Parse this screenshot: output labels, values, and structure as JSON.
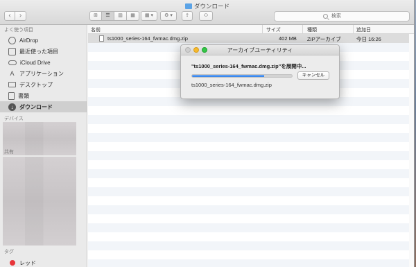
{
  "window": {
    "title": "ダウンロード"
  },
  "toolbar": {
    "back_label": "‹",
    "forward_label": "›",
    "view_buttons": [
      "⊞",
      "☰",
      "▥",
      "▦"
    ],
    "arrange_label": "▦ ▾",
    "action_label": "⚙ ▾",
    "share_label": "⇪",
    "tag_label": "⬭"
  },
  "search": {
    "placeholder": "検索"
  },
  "sidebar": {
    "favorites_header": "よく使う項目",
    "items": [
      {
        "label": "AirDrop",
        "icon": "airdrop-icon"
      },
      {
        "label": "最近使った項目",
        "icon": "recents-icon"
      },
      {
        "label": "iCloud Drive",
        "icon": "cloud-icon"
      },
      {
        "label": "アプリケーション",
        "icon": "applications-icon"
      },
      {
        "label": "デスクトップ",
        "icon": "desktop-icon"
      },
      {
        "label": "書類",
        "icon": "documents-icon"
      },
      {
        "label": "ダウンロード",
        "icon": "downloads-icon",
        "selected": true
      }
    ],
    "devices_header": "デバイス",
    "shared_header": "共有",
    "tags_header": "タグ",
    "tags": [
      {
        "label": "レッド",
        "color": "#e8363a"
      }
    ]
  },
  "columns": {
    "name": "名前",
    "size": "サイズ",
    "kind": "種類",
    "date_added": "追加日"
  },
  "files": [
    {
      "name": "ts1000_series-164_fwmac.dmg.zip",
      "size": "402 MB",
      "kind": "ZIPアーカイブ",
      "date": "今日 16:26"
    }
  ],
  "dialog": {
    "title": "アーカイブユーティリティ",
    "message": "\"ts1000_series-164_fwmac.dmg.zip\"を展開中...",
    "progress": 0.72,
    "cancel_label": "キャンセル",
    "file_name": "ts1000_series-164_fwmac.dmg.zip"
  }
}
